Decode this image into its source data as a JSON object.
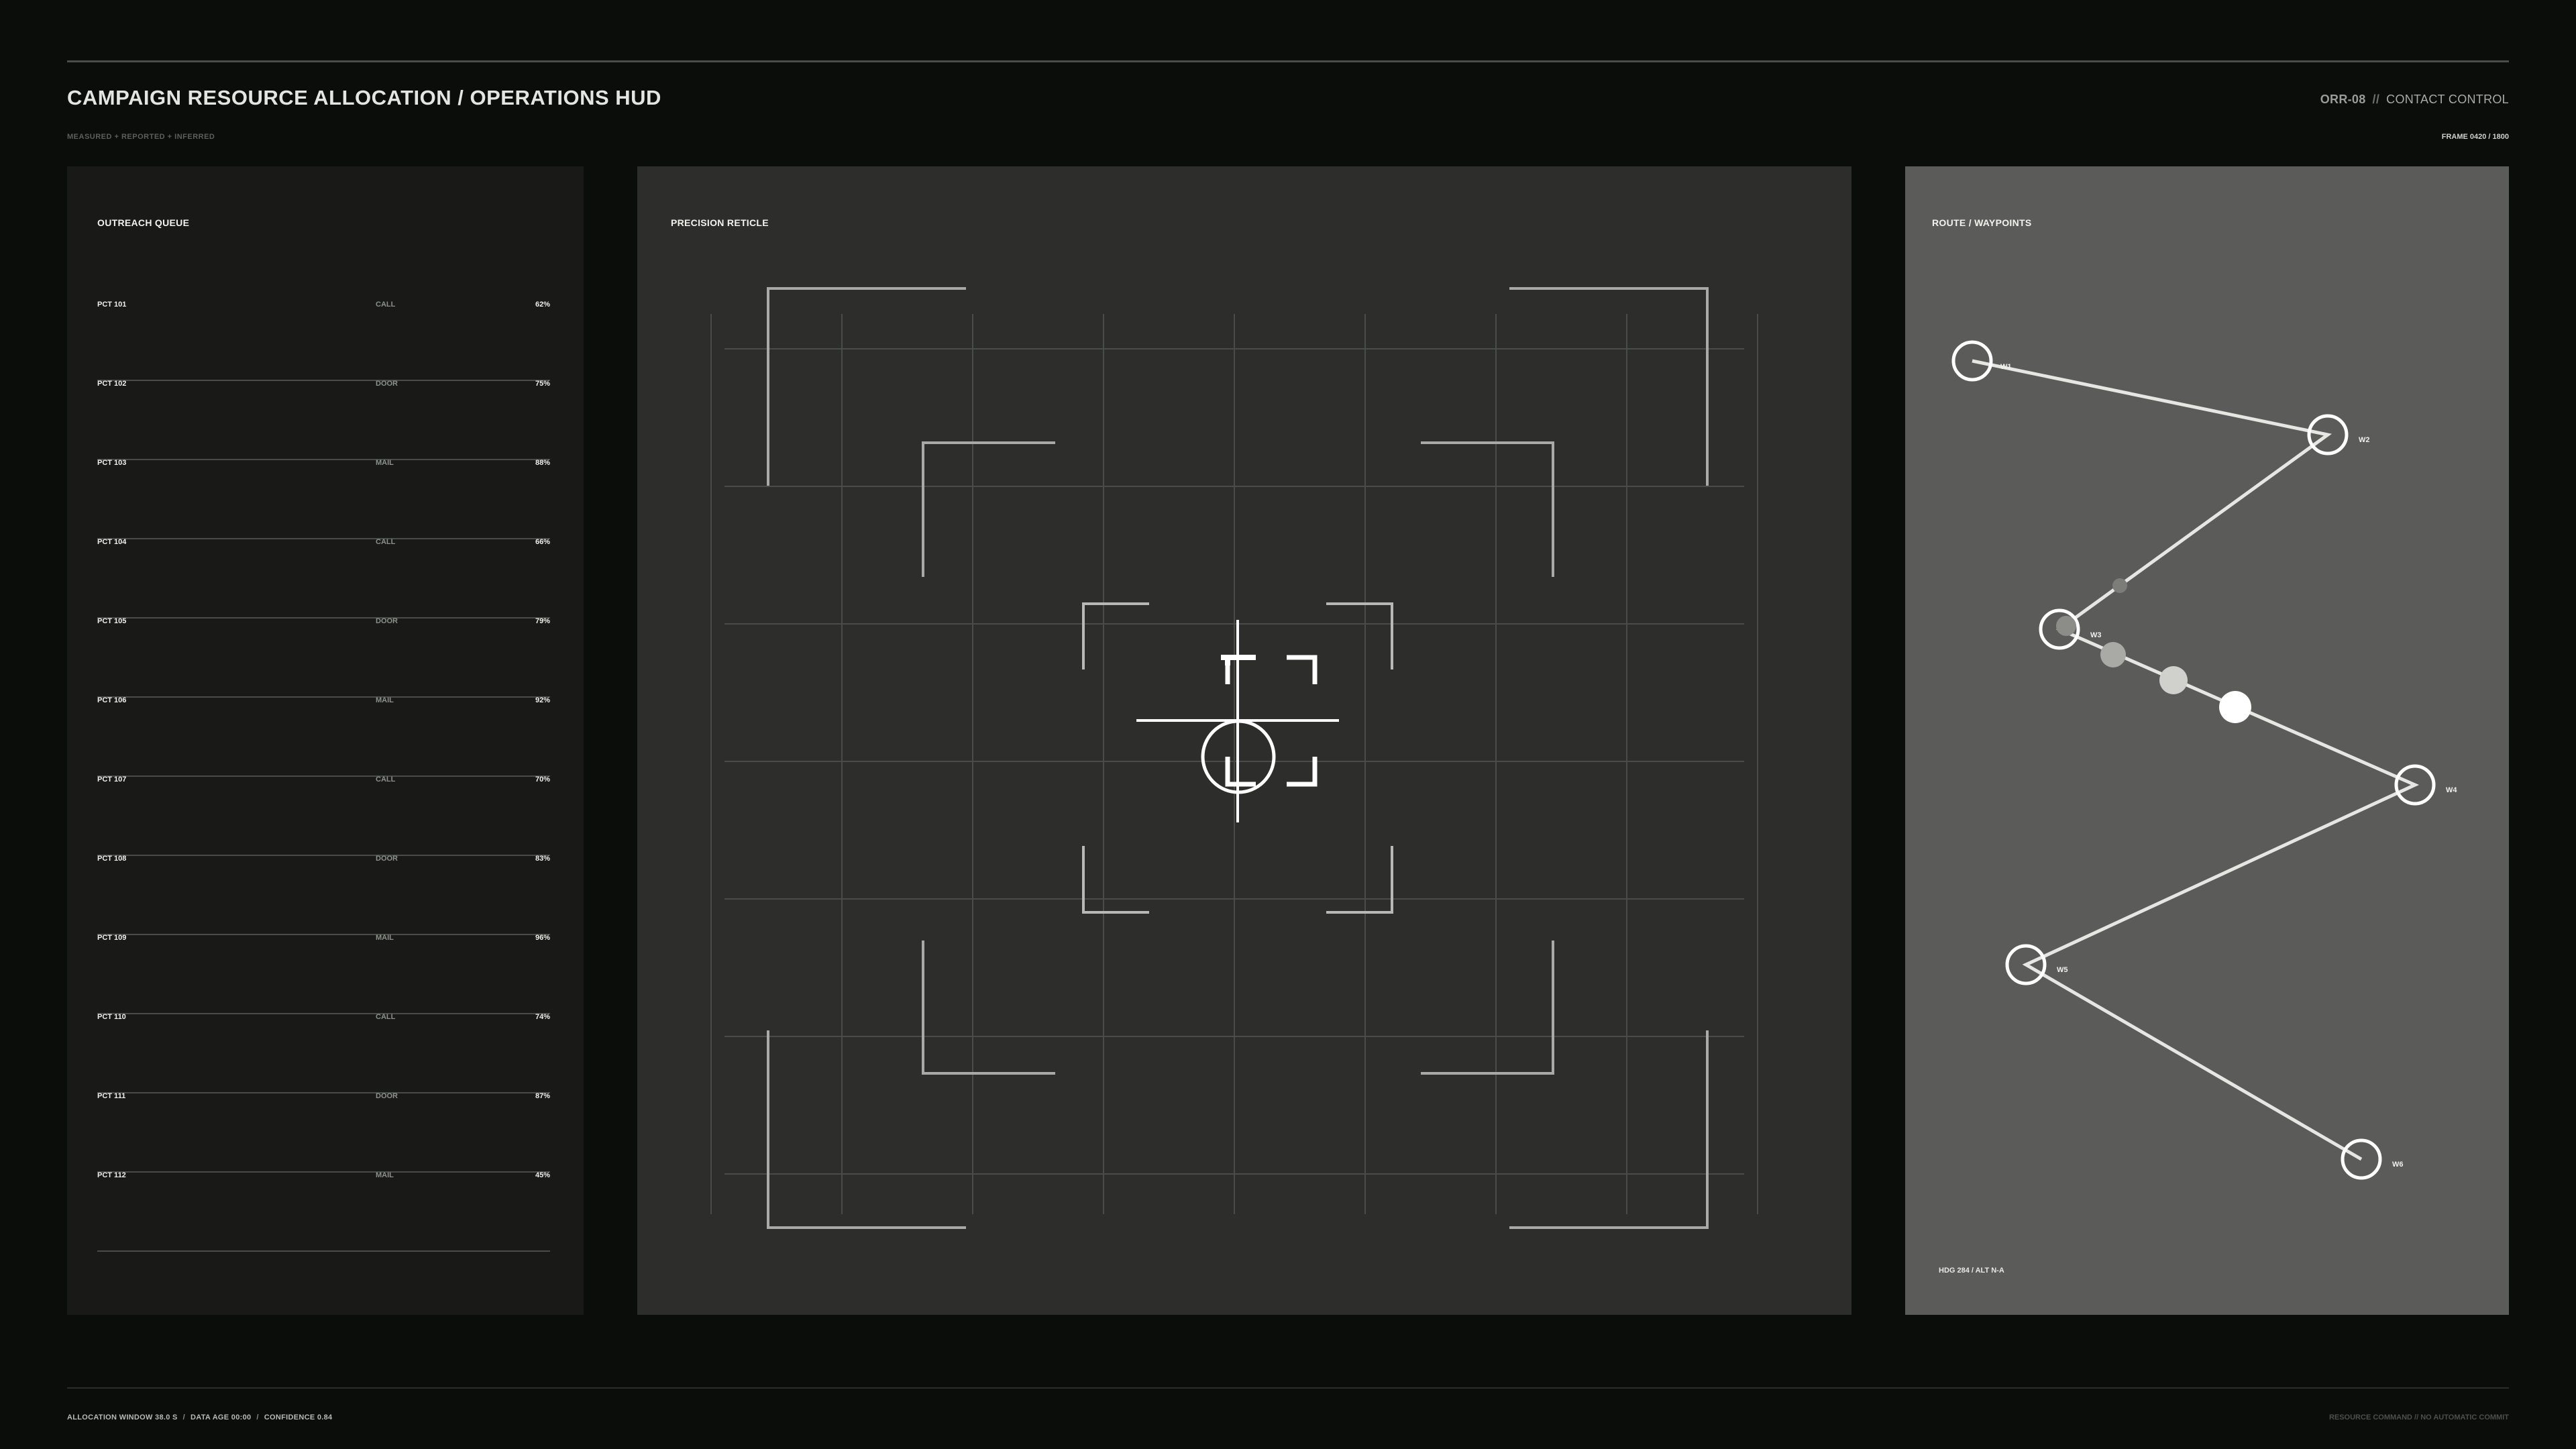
{
  "header": {
    "title": "CAMPAIGN RESOURCE ALLOCATION / OPERATIONS HUD",
    "subtitle": "MEASURED + REPORTED + INFERRED",
    "unit_id": "ORR-08",
    "separator": "//",
    "unit_role": "CONTACT CONTROL",
    "frame": "FRAME 0420 / 1800"
  },
  "queue": {
    "label": "OUTREACH QUEUE",
    "rows": [
      {
        "precinct": "PCT 101",
        "channel": "CALL",
        "value": "62%"
      },
      {
        "precinct": "PCT 102",
        "channel": "DOOR",
        "value": "75%"
      },
      {
        "precinct": "PCT 103",
        "channel": "MAIL",
        "value": "88%"
      },
      {
        "precinct": "PCT 104",
        "channel": "CALL",
        "value": "66%"
      },
      {
        "precinct": "PCT 105",
        "channel": "DOOR",
        "value": "79%"
      },
      {
        "precinct": "PCT 106",
        "channel": "MAIL",
        "value": "92%"
      },
      {
        "precinct": "PCT 107",
        "channel": "CALL",
        "value": "70%"
      },
      {
        "precinct": "PCT 108",
        "channel": "DOOR",
        "value": "83%"
      },
      {
        "precinct": "PCT 109",
        "channel": "MAIL",
        "value": "96%"
      },
      {
        "precinct": "PCT 110",
        "channel": "CALL",
        "value": "74%"
      },
      {
        "precinct": "PCT 111",
        "channel": "DOOR",
        "value": "87%"
      },
      {
        "precinct": "PCT 112",
        "channel": "MAIL",
        "value": "45%"
      }
    ]
  },
  "reticle": {
    "label": "PRECISION RETICLE"
  },
  "route": {
    "label": "ROUTE / WAYPOINTS",
    "waypoints": [
      "W1",
      "W2",
      "W3",
      "W4",
      "W5",
      "W6"
    ],
    "heading": "HDG 284 / ALT N-A"
  },
  "footer": {
    "window": "ALLOCATION WINDOW 38.0 S",
    "age": "DATA AGE 00:00",
    "confidence": "CONFIDENCE 0.84",
    "separator": "/",
    "right": "RESOURCE COMMAND // NO AUTOMATIC COMMIT"
  },
  "colors": {
    "background": "#0b0d0b",
    "queue_panel": "#191a18",
    "reticle_panel": "#2d2e2b",
    "route_panel": "#5b5c59",
    "accent": "#ffffff"
  }
}
